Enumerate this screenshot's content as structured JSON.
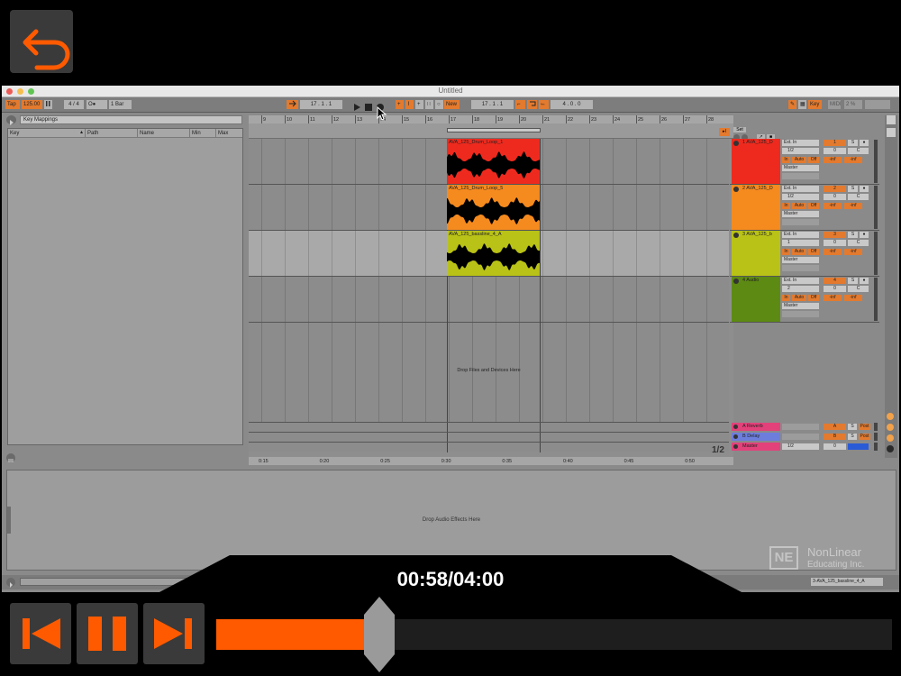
{
  "window": {
    "title": "Untitled"
  },
  "transport": {
    "tap": "Tap",
    "tempo": "125.00",
    "signature": "4 / 4",
    "metronome": "O●",
    "quantize": "1 Bar",
    "arrangement_position": "17 .  1 .  1",
    "overdub": "New",
    "loop_start": "17 .  1 .  1",
    "loop_length": "4 .  0 .  0",
    "key_button": "Key",
    "midi_button": "MIDI",
    "cpu": "2 %"
  },
  "browser": {
    "title": "Key Mappings",
    "columns": [
      "Key",
      "Path",
      "Name",
      "Min",
      "Max"
    ]
  },
  "ruler": {
    "bars": [
      "9",
      "10",
      "11",
      "12",
      "13",
      "14",
      "15",
      "16",
      "17",
      "18",
      "19",
      "20",
      "21",
      "22",
      "23",
      "24",
      "25",
      "26",
      "27",
      "28"
    ],
    "time_marks": [
      "0:15",
      "0:20",
      "0:25",
      "0:30",
      "0:35",
      "0:40",
      "0:45",
      "0:50"
    ],
    "set_label": "Set"
  },
  "tracks": [
    {
      "clip": "AVA_125_Drum_Loop_1",
      "name": "1 AVA_125_D",
      "color": "#ee2a1e",
      "wave_color": "#cc0000",
      "input": "Ext. In",
      "channel": "1/2",
      "output": "Master",
      "num": "1"
    },
    {
      "clip": "AVA_125_Drum_Loop_5",
      "name": "2 AVA_125_D",
      "color": "#f58a1e",
      "wave_color": "#e06a00",
      "input": "Ext. In",
      "channel": "1/2",
      "output": "Master",
      "num": "2"
    },
    {
      "clip": "AVA_125_bassline_4_A",
      "name": "3 AVA_125_b",
      "color": "#b9c216",
      "wave_color": "#93b200",
      "input": "Ext. In",
      "channel": "1",
      "output": "Master",
      "num": "3"
    },
    {
      "clip": "",
      "name": "4 Audio",
      "color": "#5d8a12",
      "wave_color": "",
      "input": "Ext. In",
      "channel": "2",
      "output": "Master",
      "num": "4"
    }
  ],
  "mixer_labels": {
    "in": "In",
    "auto": "Auto",
    "off": "Off",
    "s": "S",
    "c": "C",
    "zero": "0",
    "inf": "-inf"
  },
  "returns": [
    {
      "name": "A Reverb",
      "letter": "A",
      "post": "Post"
    },
    {
      "name": "B Delay",
      "letter": "B",
      "post": "Post"
    },
    {
      "name": "Master",
      "letter": "",
      "post": "",
      "channel": "1/2",
      "zero": "0"
    }
  ],
  "drop_files": "Drop Files and Devices Here",
  "drop_effects": "Drop Audio Effects Here",
  "page_indicator": "1/2",
  "status_clip": "3-AVA_125_bassline_4_A",
  "watermark": {
    "line1": "NonLinear",
    "line2": "Educating Inc.",
    "logo": "NE"
  },
  "player": {
    "time": "00:58/04:00",
    "progress": 0.2417
  },
  "colors": {
    "accent": "#ff5a00",
    "clip1": "#ee2a1e",
    "clip2": "#f58a1e",
    "clip3": "#b9c216",
    "clip4": "#5d8a12",
    "return_pink": "#e3417a",
    "master_blue": "#2a5bd7"
  }
}
